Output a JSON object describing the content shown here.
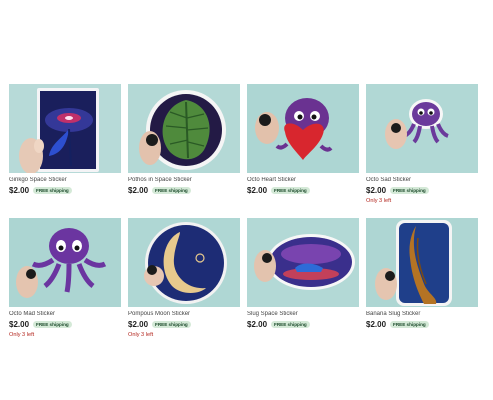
{
  "listings": [
    {
      "title": "Ginkgo Space Sticker",
      "price": "$2.00",
      "shipping": "FREE shipping",
      "stock": ""
    },
    {
      "title": "Pothos in Space Sticker",
      "price": "$2.00",
      "shipping": "FREE shipping",
      "stock": ""
    },
    {
      "title": "Octo Heart Sticker",
      "price": "$2.00",
      "shipping": "FREE shipping",
      "stock": ""
    },
    {
      "title": "Octo Sad Sticker",
      "price": "$2.00",
      "shipping": "FREE shipping",
      "stock": "Only 3 left"
    },
    {
      "title": "Octo Mad Sticker",
      "price": "$2.00",
      "shipping": "FREE shipping",
      "stock": "Only 3 left"
    },
    {
      "title": "Pompous Moon Sticker",
      "price": "$2.00",
      "shipping": "FREE shipping",
      "stock": "Only 3 left"
    },
    {
      "title": "Slug Space Sticker",
      "price": "$2.00",
      "shipping": "FREE shipping",
      "stock": ""
    },
    {
      "title": "Banana Slug Sticker",
      "price": "$2.00",
      "shipping": "FREE shipping",
      "stock": ""
    }
  ],
  "colors": {
    "background": "#ffffff",
    "shipping_badge": "#d4e9d7",
    "stock_warning": "#b3261e",
    "thumb_backdrop": "#a9d4d2"
  }
}
